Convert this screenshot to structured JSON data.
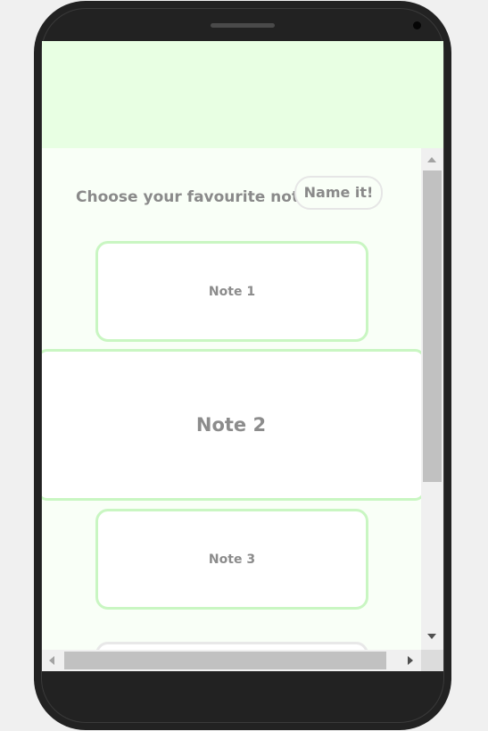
{
  "page": {
    "prompt_text": "Choose your favourite notes!",
    "name_button_label": "Name it!"
  },
  "notes": [
    {
      "label": "Note 1",
      "state": "normal"
    },
    {
      "label": "Note 2",
      "state": "focused"
    },
    {
      "label": "Note 3",
      "state": "normal"
    }
  ],
  "colors": {
    "header_band": "#e8ffe3",
    "content_background": "#f9fff7",
    "card_border": "#c9f6c2",
    "text": "#8a8a8a",
    "device_frame": "#222222"
  }
}
